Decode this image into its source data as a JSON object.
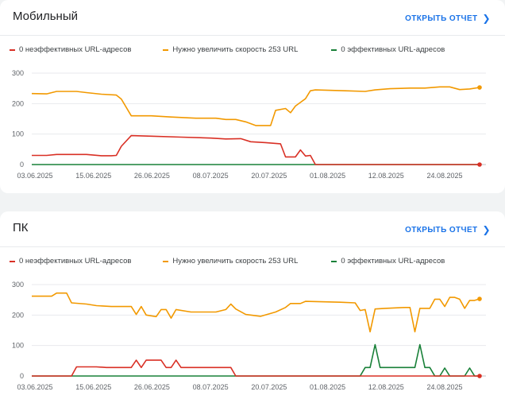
{
  "cards": {
    "mobile": {
      "title": "Мобильный",
      "report_label": "ОТКРЫТЬ ОТЧЕТ",
      "legend": [
        "0 неэффективных URL-адресов",
        "Нужно увеличить скорость 253 URL",
        "0 эффективных URL-адресов"
      ]
    },
    "pc": {
      "title": "ПК",
      "report_label": "ОТКРЫТЬ ОТЧЕТ",
      "legend": [
        "0 неэффективных URL-адресов",
        "Нужно увеличить скорость 253 URL",
        "0 эффективных URL-адресов"
      ]
    }
  },
  "colors": {
    "poor": "#d93025",
    "needs_improvement": "#f29900",
    "good": "#188038"
  },
  "icons": {
    "report_chevron": "chevron-right-icon"
  },
  "chart_data": [
    {
      "type": "line",
      "ylim": [
        0,
        300
      ],
      "yticks": [
        0,
        100,
        200,
        300
      ],
      "xlim": [
        "2025-06-03",
        "2025-09-01"
      ],
      "xtick_labels": [
        "03.06.2025",
        "15.06.2025",
        "26.06.2025",
        "08.07.2025",
        "20.07.2025",
        "01.08.2025",
        "12.08.2025",
        "24.08.2025"
      ],
      "grid": true,
      "series": [
        {
          "key": "needs_improvement",
          "points": [
            [
              "2025-06-03",
              233
            ],
            [
              "2025-06-06",
              232
            ],
            [
              "2025-06-08",
              240
            ],
            [
              "2025-06-12",
              240
            ],
            [
              "2025-06-14",
              236
            ],
            [
              "2025-06-17",
              231
            ],
            [
              "2025-06-20",
              228
            ],
            [
              "2025-06-21",
              215
            ],
            [
              "2025-06-23",
              160
            ],
            [
              "2025-06-27",
              160
            ],
            [
              "2025-07-01",
              156
            ],
            [
              "2025-07-06",
              152
            ],
            [
              "2025-07-10",
              152
            ],
            [
              "2025-07-12",
              148
            ],
            [
              "2025-07-14",
              148
            ],
            [
              "2025-07-16",
              140
            ],
            [
              "2025-07-18",
              128
            ],
            [
              "2025-07-21",
              128
            ],
            [
              "2025-07-22",
              178
            ],
            [
              "2025-07-24",
              184
            ],
            [
              "2025-07-25",
              170
            ],
            [
              "2025-07-26",
              192
            ],
            [
              "2025-07-28",
              216
            ],
            [
              "2025-07-29",
              242
            ],
            [
              "2025-07-30",
              245
            ],
            [
              "2025-08-05",
              242
            ],
            [
              "2025-08-09",
              240
            ],
            [
              "2025-08-11",
              245
            ],
            [
              "2025-08-14",
              249
            ],
            [
              "2025-08-18",
              251
            ],
            [
              "2025-08-21",
              251
            ],
            [
              "2025-08-24",
              255
            ],
            [
              "2025-08-26",
              255
            ],
            [
              "2025-08-28",
              246
            ],
            [
              "2025-08-30",
              248
            ],
            [
              "2025-09-01",
              253
            ]
          ]
        },
        {
          "key": "poor",
          "points": [
            [
              "2025-06-03",
              30
            ],
            [
              "2025-06-06",
              30
            ],
            [
              "2025-06-08",
              33
            ],
            [
              "2025-06-14",
              33
            ],
            [
              "2025-06-17",
              29
            ],
            [
              "2025-06-19",
              29
            ],
            [
              "2025-06-20",
              30
            ],
            [
              "2025-06-21",
              60
            ],
            [
              "2025-06-23",
              95
            ],
            [
              "2025-06-27",
              93
            ],
            [
              "2025-07-03",
              90
            ],
            [
              "2025-07-09",
              87
            ],
            [
              "2025-07-12",
              84
            ],
            [
              "2025-07-15",
              85
            ],
            [
              "2025-07-17",
              75
            ],
            [
              "2025-07-20",
              72
            ],
            [
              "2025-07-23",
              68
            ],
            [
              "2025-07-24",
              25
            ],
            [
              "2025-07-26",
              25
            ],
            [
              "2025-07-27",
              48
            ],
            [
              "2025-07-28",
              28
            ],
            [
              "2025-07-29",
              30
            ],
            [
              "2025-07-30",
              0
            ],
            [
              "2025-09-01",
              0
            ]
          ]
        },
        {
          "key": "good",
          "points": [
            [
              "2025-06-03",
              0
            ],
            [
              "2025-09-01",
              0
            ]
          ]
        }
      ]
    },
    {
      "type": "line",
      "ylim": [
        0,
        300
      ],
      "yticks": [
        0,
        100,
        200,
        300
      ],
      "xlim": [
        "2025-06-03",
        "2025-09-01"
      ],
      "xtick_labels": [
        "03.06.2025",
        "15.06.2025",
        "26.06.2025",
        "08.07.2025",
        "20.07.2025",
        "01.08.2025",
        "12.08.2025",
        "24.08.2025"
      ],
      "grid": true,
      "series": [
        {
          "key": "needs_improvement",
          "points": [
            [
              "2025-06-03",
              262
            ],
            [
              "2025-06-07",
              262
            ],
            [
              "2025-06-08",
              272
            ],
            [
              "2025-06-10",
              272
            ],
            [
              "2025-06-11",
              240
            ],
            [
              "2025-06-14",
              236
            ],
            [
              "2025-06-16",
              231
            ],
            [
              "2025-06-19",
              228
            ],
            [
              "2025-06-22",
              228
            ],
            [
              "2025-06-23",
              228
            ],
            [
              "2025-06-24",
              202
            ],
            [
              "2025-06-25",
              228
            ],
            [
              "2025-06-26",
              200
            ],
            [
              "2025-06-28",
              195
            ],
            [
              "2025-06-29",
              218
            ],
            [
              "2025-06-30",
              218
            ],
            [
              "2025-07-01",
              190
            ],
            [
              "2025-07-02",
              218
            ],
            [
              "2025-07-05",
              210
            ],
            [
              "2025-07-10",
              210
            ],
            [
              "2025-07-12",
              218
            ],
            [
              "2025-07-13",
              236
            ],
            [
              "2025-07-14",
              220
            ],
            [
              "2025-07-16",
              202
            ],
            [
              "2025-07-19",
              196
            ],
            [
              "2025-07-22",
              210
            ],
            [
              "2025-07-24",
              225
            ],
            [
              "2025-07-25",
              238
            ],
            [
              "2025-07-27",
              238
            ],
            [
              "2025-07-28",
              245
            ],
            [
              "2025-08-04",
              242
            ],
            [
              "2025-08-07",
              240
            ],
            [
              "2025-08-08",
              215
            ],
            [
              "2025-08-09",
              218
            ],
            [
              "2025-08-10",
              145
            ],
            [
              "2025-08-11",
              220
            ],
            [
              "2025-08-13",
              222
            ],
            [
              "2025-08-17",
              225
            ],
            [
              "2025-08-18",
              225
            ],
            [
              "2025-08-19",
              145
            ],
            [
              "2025-08-20",
              222
            ],
            [
              "2025-08-22",
              222
            ],
            [
              "2025-08-23",
              252
            ],
            [
              "2025-08-24",
              252
            ],
            [
              "2025-08-25",
              228
            ],
            [
              "2025-08-26",
              258
            ],
            [
              "2025-08-27",
              258
            ],
            [
              "2025-08-28",
              252
            ],
            [
              "2025-08-29",
              222
            ],
            [
              "2025-08-30",
              248
            ],
            [
              "2025-08-31",
              248
            ],
            [
              "2025-09-01",
              253
            ]
          ]
        },
        {
          "key": "poor",
          "points": [
            [
              "2025-06-03",
              0
            ],
            [
              "2025-06-11",
              0
            ],
            [
              "2025-06-12",
              30
            ],
            [
              "2025-06-16",
              30
            ],
            [
              "2025-06-18",
              28
            ],
            [
              "2025-06-20",
              28
            ],
            [
              "2025-06-23",
              28
            ],
            [
              "2025-06-24",
              52
            ],
            [
              "2025-06-25",
              28
            ],
            [
              "2025-06-26",
              52
            ],
            [
              "2025-06-29",
              52
            ],
            [
              "2025-06-30",
              28
            ],
            [
              "2025-07-01",
              28
            ],
            [
              "2025-07-02",
              52
            ],
            [
              "2025-07-03",
              28
            ],
            [
              "2025-07-13",
              28
            ],
            [
              "2025-07-14",
              0
            ],
            [
              "2025-09-01",
              0
            ]
          ]
        },
        {
          "key": "good",
          "points": [
            [
              "2025-06-03",
              0
            ],
            [
              "2025-08-08",
              0
            ],
            [
              "2025-08-09",
              28
            ],
            [
              "2025-08-10",
              28
            ],
            [
              "2025-08-11",
              103
            ],
            [
              "2025-08-12",
              28
            ],
            [
              "2025-08-19",
              28
            ],
            [
              "2025-08-20",
              103
            ],
            [
              "2025-08-21",
              28
            ],
            [
              "2025-08-22",
              28
            ],
            [
              "2025-08-23",
              0
            ],
            [
              "2025-08-24",
              0
            ],
            [
              "2025-08-25",
              26
            ],
            [
              "2025-08-26",
              0
            ],
            [
              "2025-08-29",
              0
            ],
            [
              "2025-08-30",
              26
            ],
            [
              "2025-08-31",
              0
            ],
            [
              "2025-09-01",
              0
            ]
          ]
        }
      ]
    }
  ]
}
